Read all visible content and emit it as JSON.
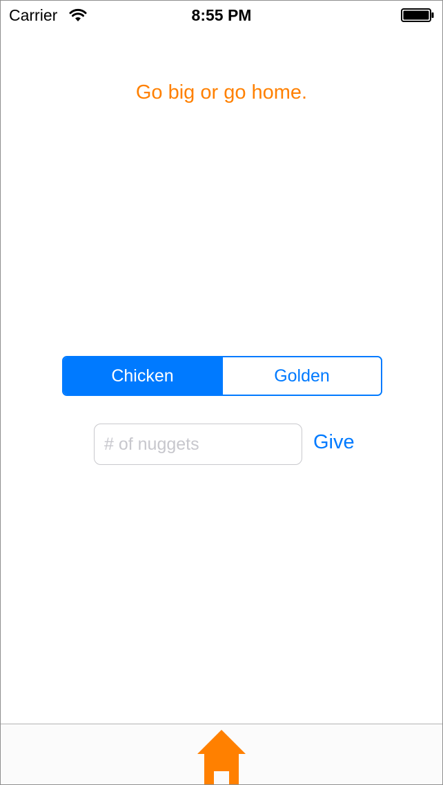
{
  "status_bar": {
    "carrier": "Carrier",
    "time": "8:55 PM",
    "wifi_icon": "wifi-icon",
    "battery_icon": "battery-icon"
  },
  "motto": "Go big or go home.",
  "segmented_control": {
    "options": [
      "Chicken",
      "Golden"
    ],
    "selected": "Chicken"
  },
  "nuggets_input": {
    "value": "",
    "placeholder": "# of nuggets"
  },
  "give_button": "Give",
  "tab_bar": {
    "items": [
      {
        "icon": "home-icon",
        "selected": true
      }
    ]
  },
  "colors": {
    "accent": "#007aff",
    "motto": "#ff8000",
    "home_icon": "#ff8000"
  }
}
